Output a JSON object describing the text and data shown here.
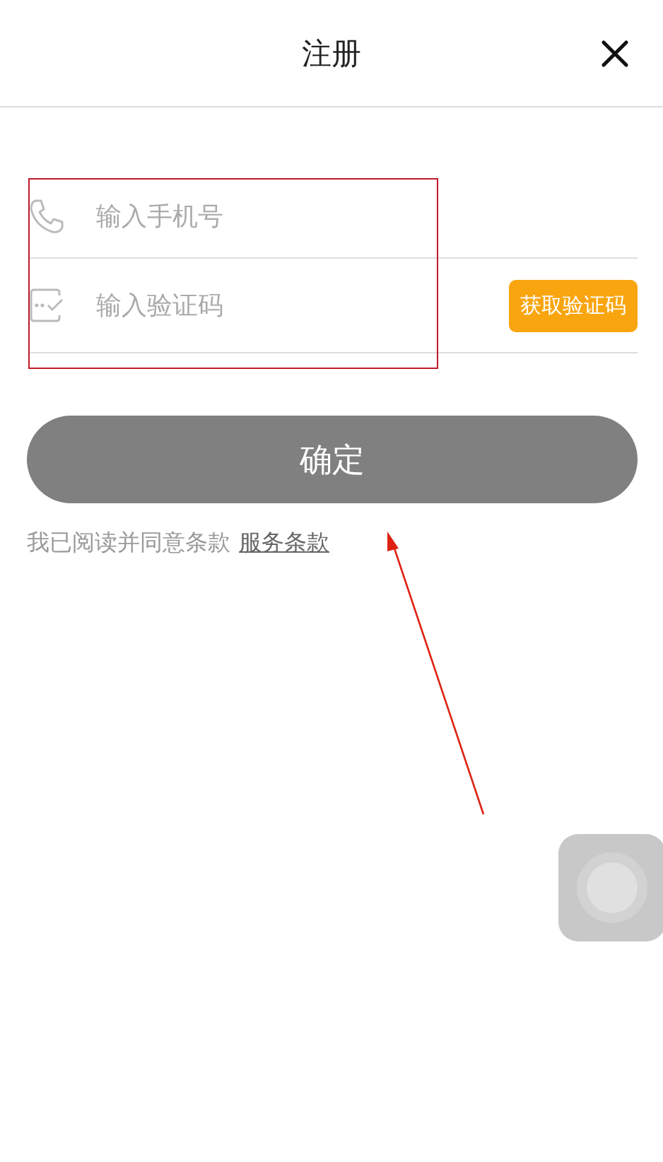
{
  "header": {
    "title": "注册"
  },
  "fields": [
    {
      "kind": "phone",
      "placeholder": "输入手机号"
    },
    {
      "kind": "code",
      "placeholder": "输入验证码",
      "action": "获取验证码"
    }
  ],
  "submit": {
    "label": "确定",
    "disabled": true
  },
  "terms": {
    "text": "我已阅读并同意条款",
    "link": "服务条款"
  }
}
